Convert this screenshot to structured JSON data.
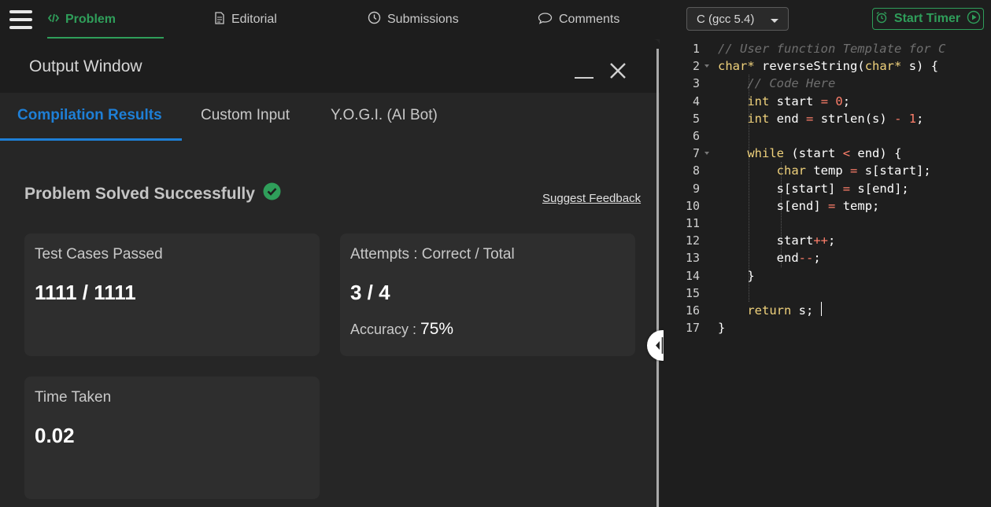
{
  "nav": {
    "tabs": [
      {
        "label": "Problem",
        "icon": "code-icon"
      },
      {
        "label": "Editorial",
        "icon": "document-icon"
      },
      {
        "label": "Submissions",
        "icon": "clock-icon"
      },
      {
        "label": "Comments",
        "icon": "comment-icon"
      }
    ]
  },
  "output": {
    "title": "Output Window",
    "tabs": [
      "Compilation Results",
      "Custom Input",
      "Y.O.G.I. (AI Bot)"
    ],
    "status": "Problem Solved Successfully",
    "feedback": "Suggest Feedback",
    "cards": {
      "tests": {
        "label": "Test Cases Passed",
        "value": "1111 / 1111"
      },
      "attempts": {
        "label": "Attempts : Correct / Total",
        "value": "3 / 4",
        "accuracy_label": "Accuracy :",
        "accuracy_value": "75%"
      },
      "time": {
        "label": "Time Taken",
        "value": "0.02"
      }
    }
  },
  "editor": {
    "language": "C (gcc 5.4)",
    "timer_label": "Start Timer",
    "line_numbers": [
      "1",
      "2",
      "3",
      "4",
      "5",
      "6",
      "7",
      "8",
      "9",
      "10",
      "11",
      "12",
      "13",
      "14",
      "15",
      "16",
      "17"
    ],
    "lines": [
      "// User function Template for C",
      "char* reverseString(char* s) {",
      "    // Code Here",
      "    int start = 0;",
      "    int end = strlen(s) - 1;",
      "",
      "    while (start < end) {",
      "        char temp = s[start];",
      "        s[start] = s[end];",
      "        s[end] = temp;",
      "",
      "        start++;",
      "        end--;",
      "    }",
      "",
      "    return s;",
      "}"
    ]
  },
  "colors": {
    "accent_green": "#2f9e5a",
    "accent_blue": "#1e7fd6",
    "keyword": "#f0d27c",
    "number": "#ff7f6b",
    "comment": "#6f6f6f"
  }
}
